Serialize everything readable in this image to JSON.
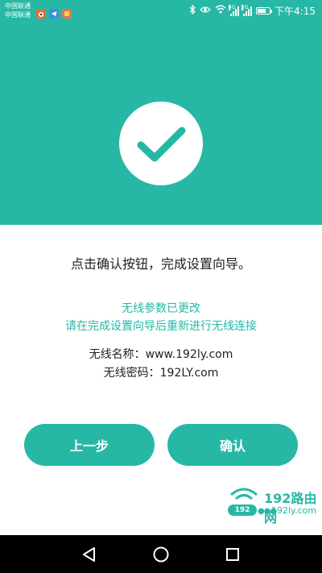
{
  "status_bar": {
    "carrier_line1": "中国联通",
    "carrier_line2": "中国联通",
    "app_icons": [
      "weibo-icon",
      "telegram-icon",
      "photos-icon"
    ],
    "icons": [
      "bluetooth-icon",
      "eye-icon",
      "wifi-icon",
      "signal-4g-icon",
      "signal-2g-icon",
      "battery-icon"
    ],
    "signal1_tag": "4G",
    "signal2_tag": "2G",
    "time": "下午4:15"
  },
  "colors": {
    "accent": "#26b8a5",
    "text": "#222222",
    "background": "#ffffff",
    "nav_bar": "#000000"
  },
  "hero": {
    "icon": "checkmark-icon"
  },
  "content": {
    "instruction": "点击确认按钮，完成设置向导。",
    "notice_line1": "无线参数已更改",
    "notice_line2": "请在完成设置向导后重新进行无线连接",
    "wifi_name": "无线名称：www.192ly.com",
    "wifi_password": "无线密码：192LY.com"
  },
  "buttons": {
    "prev_label": "上一步",
    "confirm_label": "确认"
  },
  "watermark": {
    "brand": "192路由网",
    "pill": "192",
    "url": "192ly.com"
  },
  "nav_bar": {
    "icons": [
      "back-icon",
      "home-icon",
      "recent-apps-icon"
    ]
  }
}
